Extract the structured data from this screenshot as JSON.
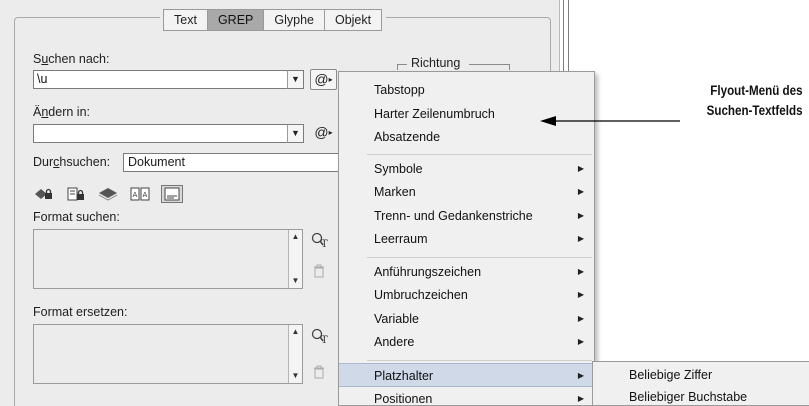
{
  "tabs": [
    "Text",
    "GREP",
    "Glyphe",
    "Objekt"
  ],
  "search": {
    "label_pre": "S",
    "label_ul": "u",
    "label_post": "chen nach:",
    "value": "\\u",
    "at_label": "@",
    "direction_label": "Richtung"
  },
  "replace": {
    "label_pre": "Ä",
    "label_ul": "n",
    "label_post": "dern in:",
    "value": "",
    "at_label": "@"
  },
  "scope": {
    "label_pre": "Dur",
    "label_ul": "c",
    "label_post": "hsuchen:",
    "value": "Dokument"
  },
  "format_search_label": "Format suchen:",
  "format_replace_label": "Format ersetzen:",
  "menu": {
    "items": [
      {
        "label": "Tabstopp",
        "submenu": false
      },
      {
        "label": "Harter Zeilenumbruch",
        "submenu": false
      },
      {
        "label": "Absatzende",
        "submenu": false
      },
      {
        "label": "Symbole",
        "submenu": true
      },
      {
        "label": "Marken",
        "submenu": true
      },
      {
        "label": "Trenn- und Gedankenstriche",
        "submenu": true
      },
      {
        "label": "Leerraum",
        "submenu": true
      },
      {
        "label": "Anführungszeichen",
        "submenu": true
      },
      {
        "label": "Umbruchzeichen",
        "submenu": true
      },
      {
        "label": "Variable",
        "submenu": true
      },
      {
        "label": "Andere",
        "submenu": true
      },
      {
        "label": "Platzhalter",
        "submenu": true
      },
      {
        "label": "Positionen",
        "submenu": true
      }
    ],
    "highlighted": "Platzhalter"
  },
  "submenu": {
    "items": [
      "Beliebige Ziffer",
      "Beliebiger Buchstabe"
    ]
  },
  "annotation": {
    "line1": "Flyout-Menü des",
    "line2": "Suchen-Textfelds"
  },
  "colors": {
    "dialog_bg": "#ececec",
    "menu_bg": "#f0f0f0",
    "menu_highlight": "#cfd9e8",
    "active_tab": "#a9a9a9"
  }
}
